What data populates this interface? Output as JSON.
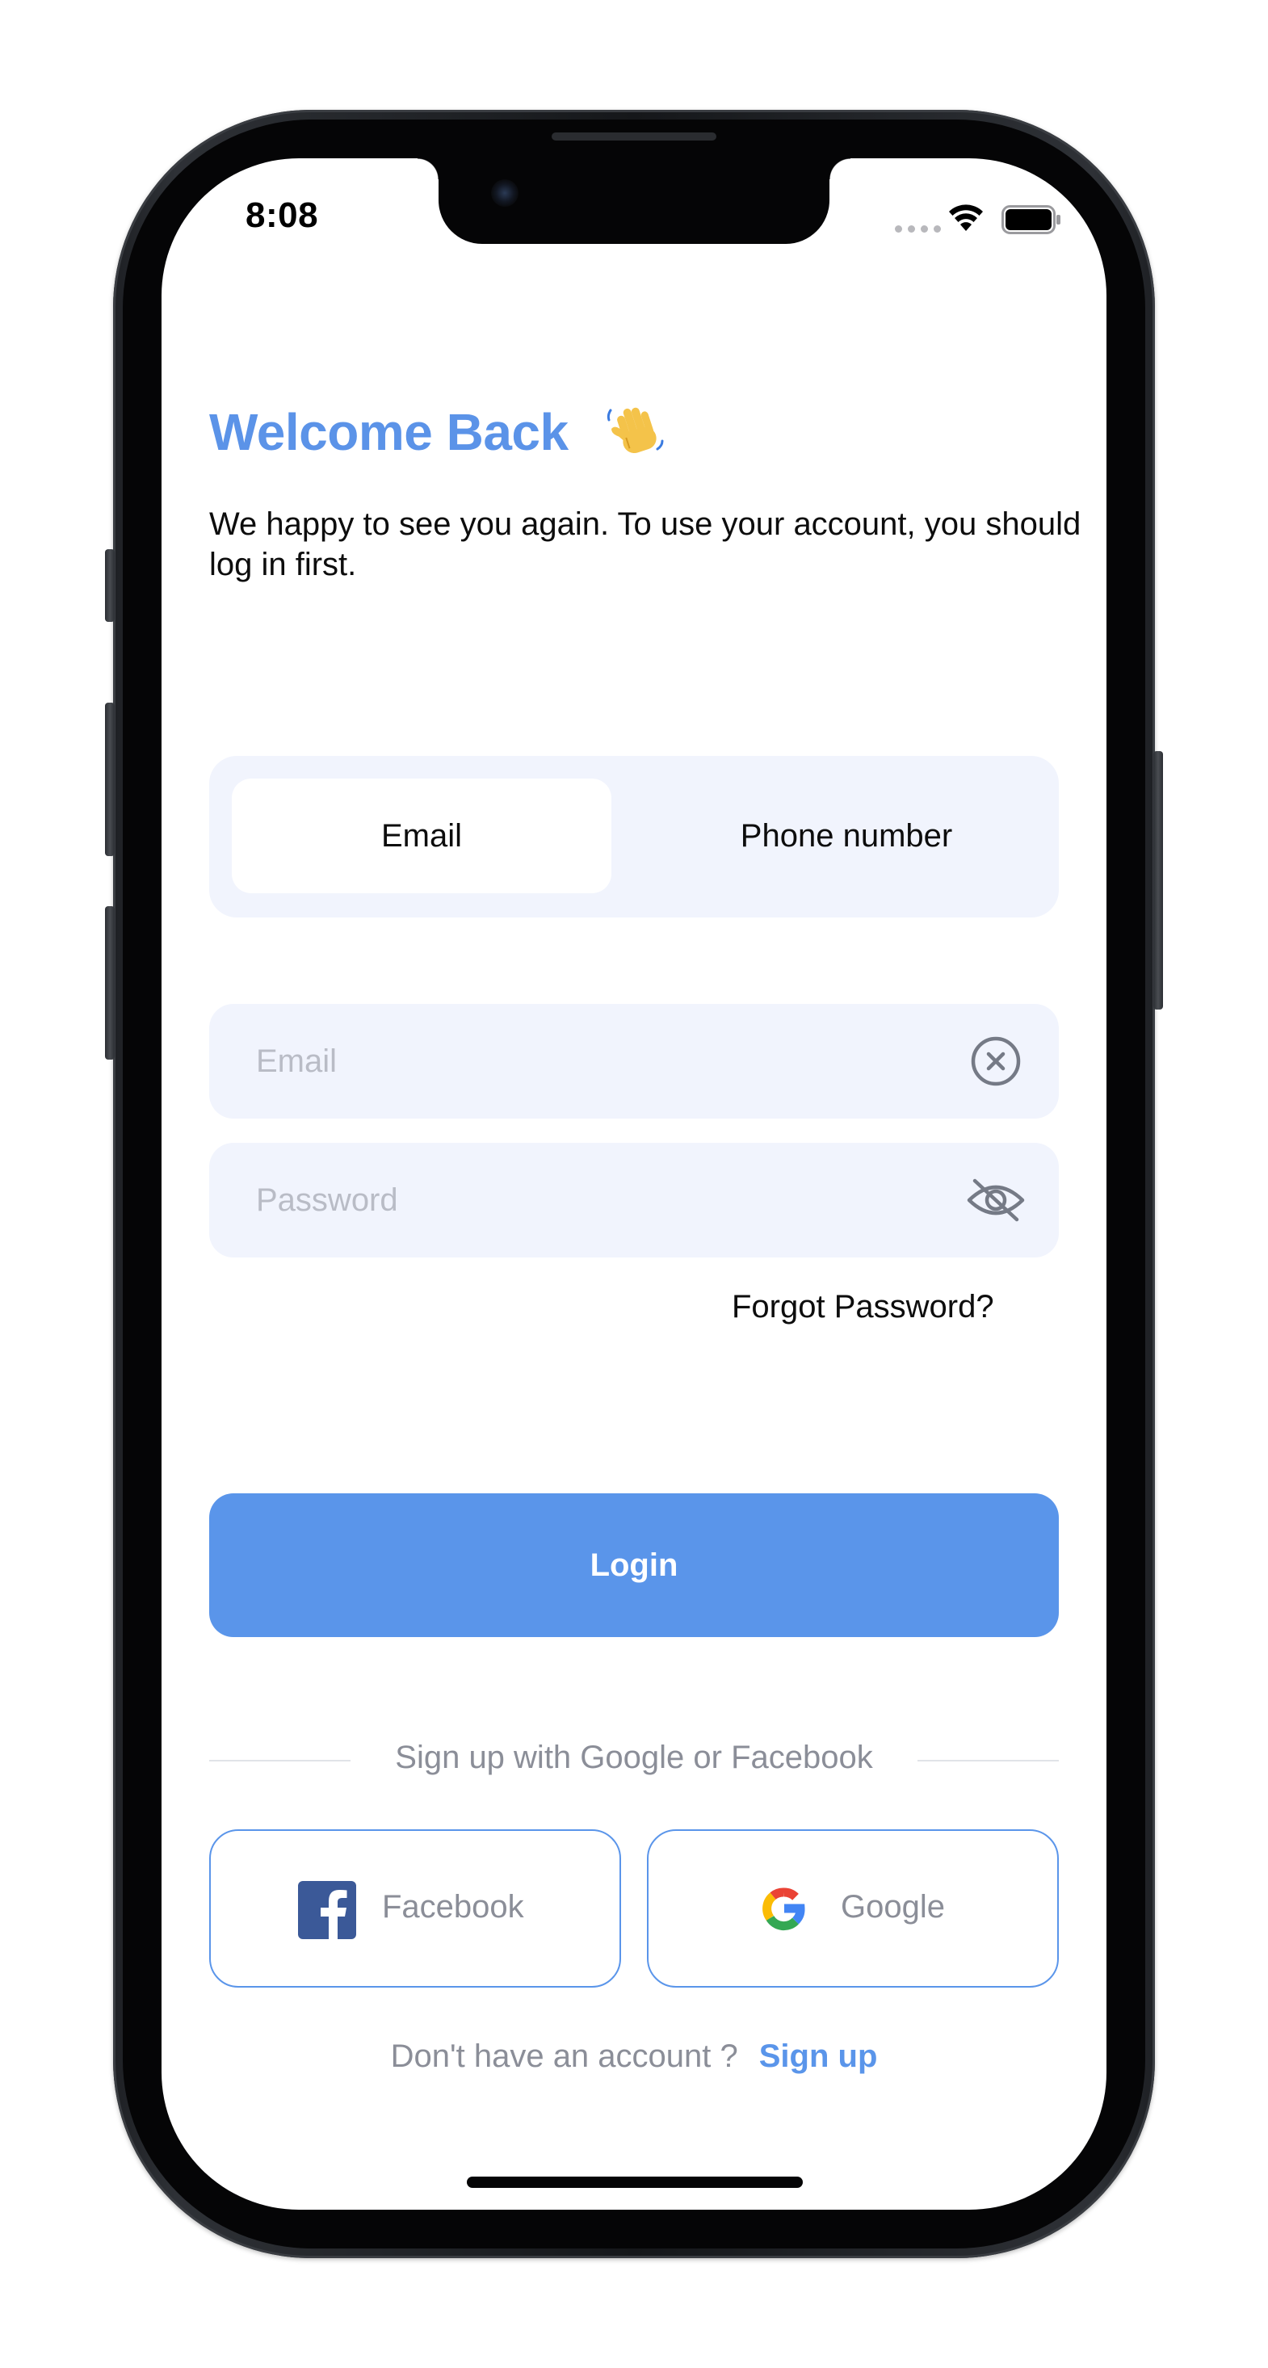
{
  "status_bar": {
    "time": "8:08",
    "wifi_icon": "wifi-icon",
    "battery_icon": "battery-full-icon",
    "signal_icon": "cellular-dots-icon"
  },
  "header": {
    "title": "Welcome Back",
    "title_emoji_icon": "waving-hand-icon",
    "subtitle": "We happy to see you again. To use your account, you should log in first."
  },
  "login_method_tabs": [
    {
      "label": "Email",
      "selected": true
    },
    {
      "label": "Phone number",
      "selected": false
    }
  ],
  "form": {
    "email": {
      "placeholder": "Email",
      "value": "",
      "icon": "clear-circle-x-icon"
    },
    "password": {
      "placeholder": "Password",
      "value": "",
      "icon": "eye-slash-icon"
    },
    "forgot_password_label": "Forgot Password?"
  },
  "login_button_label": "Login",
  "social": {
    "divider_text": "Sign up with Google or Facebook",
    "facebook_label": "Facebook",
    "google_label": "Google"
  },
  "signup": {
    "prompt": "Don't have an account ?",
    "link": "Sign up"
  },
  "colors": {
    "accent": "#5a95ea",
    "field_background": "#f1f4fd",
    "muted_text": "#8b8e98",
    "placeholder_text": "#b9bcc6"
  }
}
